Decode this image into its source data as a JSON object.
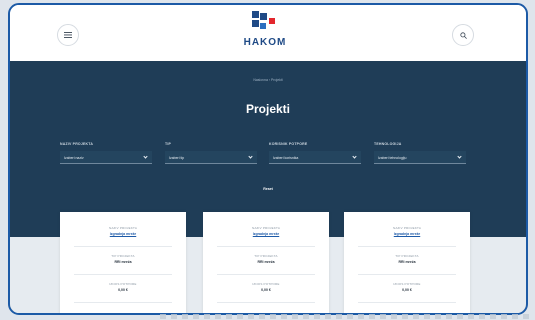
{
  "header": {
    "logo_text": "HAKOM",
    "menu_icon": "hamburger-menu-icon",
    "search_icon": "search-icon"
  },
  "hero": {
    "breadcrumb": "Naslovna  ›  Projekti",
    "title": "Projekti"
  },
  "filters": [
    {
      "label": "NAZIV PROJEKTA",
      "value": "Izaberi naziv"
    },
    {
      "label": "TIP",
      "value": "Izaberi tip"
    },
    {
      "label": "KORISNIK POTPORE",
      "value": "Izaberi korisnika"
    },
    {
      "label": "TEHNOLOGIJA",
      "value": "Izaberi tehnologiju"
    }
  ],
  "reset_label": "Reset",
  "cards": [
    {
      "name_label": "NAZIV PROJEKTA",
      "name_value": "Izgradnja mreže",
      "type_label": "TIP PROJEKTA",
      "type_value": "RRI mreža",
      "value_label": "IZNOS POTPORE",
      "value_value": "0,00 €"
    },
    {
      "name_label": "NAZIV PROJEKTA",
      "name_value": "Izgradnja mreže",
      "type_label": "TIP PROJEKTA",
      "type_value": "RRI mreža",
      "value_label": "IZNOS POTPORE",
      "value_value": "0,00 €"
    },
    {
      "name_label": "NAZIV PROJEKTA",
      "name_value": "Izgradnja mreže",
      "type_label": "TIP PROJEKTA",
      "type_value": "RRI mreža",
      "value_label": "IZNOS POTPORE",
      "value_value": "0,00 €"
    }
  ],
  "colors": {
    "frame": "#1c5aa6",
    "hero_bg": "#1f3d57",
    "logo_blue": "#1f4a86",
    "logo_red": "#e3262d",
    "link": "#1d5aa8"
  }
}
